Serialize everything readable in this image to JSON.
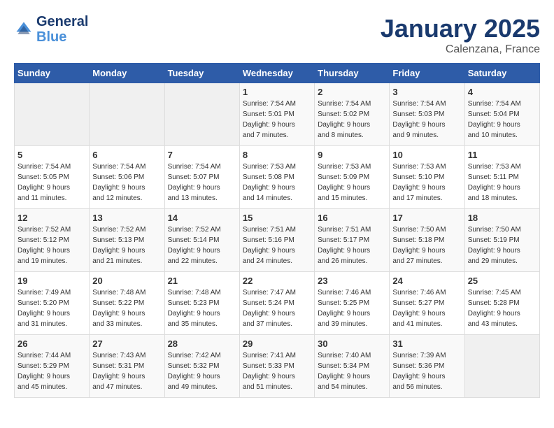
{
  "logo": {
    "line1": "General",
    "line2": "Blue"
  },
  "title": "January 2025",
  "subtitle": "Calenzana, France",
  "days_header": [
    "Sunday",
    "Monday",
    "Tuesday",
    "Wednesday",
    "Thursday",
    "Friday",
    "Saturday"
  ],
  "weeks": [
    [
      {
        "day": "",
        "info": ""
      },
      {
        "day": "",
        "info": ""
      },
      {
        "day": "",
        "info": ""
      },
      {
        "day": "1",
        "info": "Sunrise: 7:54 AM\nSunset: 5:01 PM\nDaylight: 9 hours\nand 7 minutes."
      },
      {
        "day": "2",
        "info": "Sunrise: 7:54 AM\nSunset: 5:02 PM\nDaylight: 9 hours\nand 8 minutes."
      },
      {
        "day": "3",
        "info": "Sunrise: 7:54 AM\nSunset: 5:03 PM\nDaylight: 9 hours\nand 9 minutes."
      },
      {
        "day": "4",
        "info": "Sunrise: 7:54 AM\nSunset: 5:04 PM\nDaylight: 9 hours\nand 10 minutes."
      }
    ],
    [
      {
        "day": "5",
        "info": "Sunrise: 7:54 AM\nSunset: 5:05 PM\nDaylight: 9 hours\nand 11 minutes."
      },
      {
        "day": "6",
        "info": "Sunrise: 7:54 AM\nSunset: 5:06 PM\nDaylight: 9 hours\nand 12 minutes."
      },
      {
        "day": "7",
        "info": "Sunrise: 7:54 AM\nSunset: 5:07 PM\nDaylight: 9 hours\nand 13 minutes."
      },
      {
        "day": "8",
        "info": "Sunrise: 7:53 AM\nSunset: 5:08 PM\nDaylight: 9 hours\nand 14 minutes."
      },
      {
        "day": "9",
        "info": "Sunrise: 7:53 AM\nSunset: 5:09 PM\nDaylight: 9 hours\nand 15 minutes."
      },
      {
        "day": "10",
        "info": "Sunrise: 7:53 AM\nSunset: 5:10 PM\nDaylight: 9 hours\nand 17 minutes."
      },
      {
        "day": "11",
        "info": "Sunrise: 7:53 AM\nSunset: 5:11 PM\nDaylight: 9 hours\nand 18 minutes."
      }
    ],
    [
      {
        "day": "12",
        "info": "Sunrise: 7:52 AM\nSunset: 5:12 PM\nDaylight: 9 hours\nand 19 minutes."
      },
      {
        "day": "13",
        "info": "Sunrise: 7:52 AM\nSunset: 5:13 PM\nDaylight: 9 hours\nand 21 minutes."
      },
      {
        "day": "14",
        "info": "Sunrise: 7:52 AM\nSunset: 5:14 PM\nDaylight: 9 hours\nand 22 minutes."
      },
      {
        "day": "15",
        "info": "Sunrise: 7:51 AM\nSunset: 5:16 PM\nDaylight: 9 hours\nand 24 minutes."
      },
      {
        "day": "16",
        "info": "Sunrise: 7:51 AM\nSunset: 5:17 PM\nDaylight: 9 hours\nand 26 minutes."
      },
      {
        "day": "17",
        "info": "Sunrise: 7:50 AM\nSunset: 5:18 PM\nDaylight: 9 hours\nand 27 minutes."
      },
      {
        "day": "18",
        "info": "Sunrise: 7:50 AM\nSunset: 5:19 PM\nDaylight: 9 hours\nand 29 minutes."
      }
    ],
    [
      {
        "day": "19",
        "info": "Sunrise: 7:49 AM\nSunset: 5:20 PM\nDaylight: 9 hours\nand 31 minutes."
      },
      {
        "day": "20",
        "info": "Sunrise: 7:48 AM\nSunset: 5:22 PM\nDaylight: 9 hours\nand 33 minutes."
      },
      {
        "day": "21",
        "info": "Sunrise: 7:48 AM\nSunset: 5:23 PM\nDaylight: 9 hours\nand 35 minutes."
      },
      {
        "day": "22",
        "info": "Sunrise: 7:47 AM\nSunset: 5:24 PM\nDaylight: 9 hours\nand 37 minutes."
      },
      {
        "day": "23",
        "info": "Sunrise: 7:46 AM\nSunset: 5:25 PM\nDaylight: 9 hours\nand 39 minutes."
      },
      {
        "day": "24",
        "info": "Sunrise: 7:46 AM\nSunset: 5:27 PM\nDaylight: 9 hours\nand 41 minutes."
      },
      {
        "day": "25",
        "info": "Sunrise: 7:45 AM\nSunset: 5:28 PM\nDaylight: 9 hours\nand 43 minutes."
      }
    ],
    [
      {
        "day": "26",
        "info": "Sunrise: 7:44 AM\nSunset: 5:29 PM\nDaylight: 9 hours\nand 45 minutes."
      },
      {
        "day": "27",
        "info": "Sunrise: 7:43 AM\nSunset: 5:31 PM\nDaylight: 9 hours\nand 47 minutes."
      },
      {
        "day": "28",
        "info": "Sunrise: 7:42 AM\nSunset: 5:32 PM\nDaylight: 9 hours\nand 49 minutes."
      },
      {
        "day": "29",
        "info": "Sunrise: 7:41 AM\nSunset: 5:33 PM\nDaylight: 9 hours\nand 51 minutes."
      },
      {
        "day": "30",
        "info": "Sunrise: 7:40 AM\nSunset: 5:34 PM\nDaylight: 9 hours\nand 54 minutes."
      },
      {
        "day": "31",
        "info": "Sunrise: 7:39 AM\nSunset: 5:36 PM\nDaylight: 9 hours\nand 56 minutes."
      },
      {
        "day": "",
        "info": ""
      }
    ]
  ]
}
